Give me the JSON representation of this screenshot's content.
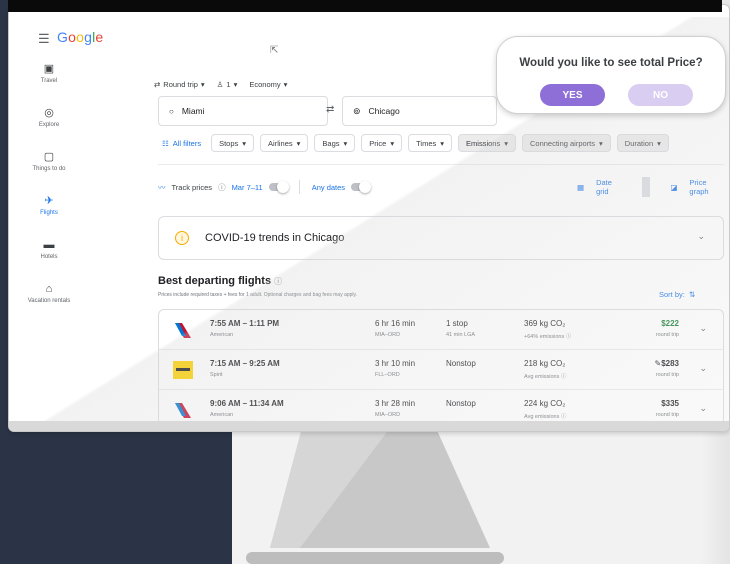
{
  "header": {
    "logo": "Google"
  },
  "sidebar": {
    "items": [
      {
        "label": "Travel",
        "icon": "travel-icon"
      },
      {
        "label": "Explore",
        "icon": "explore-icon"
      },
      {
        "label": "Things to do",
        "icon": "things-to-do-icon"
      },
      {
        "label": "Flights",
        "icon": "flights-icon",
        "active": true
      },
      {
        "label": "Hotels",
        "icon": "hotels-icon"
      },
      {
        "label": "Vacation rentals",
        "icon": "vacation-rentals-icon"
      }
    ]
  },
  "search": {
    "trip_type": "Round trip",
    "passengers": "1",
    "cabin": "Economy",
    "origin": "Miami",
    "destination": "Chicago"
  },
  "filters": [
    "All filters",
    "Stops",
    "Airlines",
    "Bags",
    "Price",
    "Times",
    "Emissions",
    "Connecting airports",
    "Duration"
  ],
  "tracking": {
    "track_label": "Track prices",
    "dates": "Mar 7–11",
    "any_dates": "Any dates",
    "date_grid": "Date grid",
    "price_graph": "Price graph"
  },
  "covid": {
    "text": "COVID-19 trends in Chicago"
  },
  "results": {
    "title": "Best departing flights",
    "subtitle": "Prices include required taxes + fees for 1 adult. Optional charges and bag fees may apply.",
    "sort_label": "Sort by:",
    "flights": [
      {
        "times": "7:55 AM – 1:11 PM",
        "carrier": "American",
        "duration": "6 hr 16 min",
        "route": "MIA–ORD",
        "stops": "1 stop",
        "layover": "41 min LGA",
        "co2": "369 kg CO₂",
        "emissions": "+64% emissions ⓘ",
        "price": "$222",
        "price_note": "round trip"
      },
      {
        "times": "7:15 AM – 9:25 AM",
        "carrier": "Spirit",
        "duration": "3 hr 10 min",
        "route": "FLL–ORD",
        "stops": "Nonstop",
        "layover": "",
        "co2": "218 kg CO₂",
        "emissions": "Avg emissions ⓘ",
        "price": "$283",
        "price_note": "round trip"
      },
      {
        "times": "9:06 AM – 11:34 AM",
        "carrier": "American",
        "duration": "3 hr 28 min",
        "route": "MIA–ORD",
        "stops": "Nonstop",
        "layover": "",
        "co2": "224 kg CO₂",
        "emissions": "Avg emissions ⓘ",
        "price": "$335",
        "price_note": "round trip"
      }
    ]
  },
  "popup": {
    "question": "Would you like to see total Price?",
    "yes": "YES",
    "no": "NO"
  },
  "colors": {
    "accent_blue": "#1a73e8",
    "popup_yes": "#8e6fd7",
    "popup_no": "#d9cdf2",
    "price_green": "#188038",
    "backdrop_navy": "#2b3446"
  }
}
